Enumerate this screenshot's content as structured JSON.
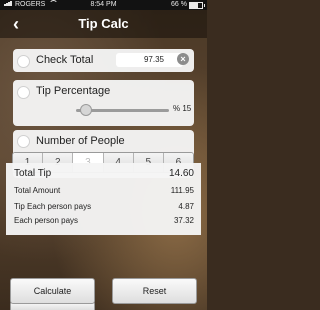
{
  "status": {
    "carrier": "ROGERS",
    "time": "8:54 PM",
    "battery": "66 %",
    "battery_level": 0.66
  },
  "navbar": {
    "back_icon": "chevron-left-icon",
    "title": "Tip Calc"
  },
  "check": {
    "label": "Check Total",
    "value": "97.35",
    "clear_icon": "clear-x-icon"
  },
  "tip": {
    "label": "Tip Percentage",
    "value_text": "% 15",
    "slider_fraction": 0.05
  },
  "people": {
    "label": "Number of People",
    "options": [
      "1",
      "2",
      "3",
      "4",
      "5",
      "6"
    ],
    "selected": "3"
  },
  "results": {
    "total_tip_label": "Total Tip",
    "total_tip": "14.60",
    "total_amount_label": "Total Amount",
    "total_amount": "111.95",
    "tip_each_label": "Tip Each person pays",
    "tip_each": "4.87",
    "each_label": "Each person pays",
    "each": "37.32"
  },
  "buttons": {
    "calculate": "Calculate",
    "reset": "Reset"
  }
}
